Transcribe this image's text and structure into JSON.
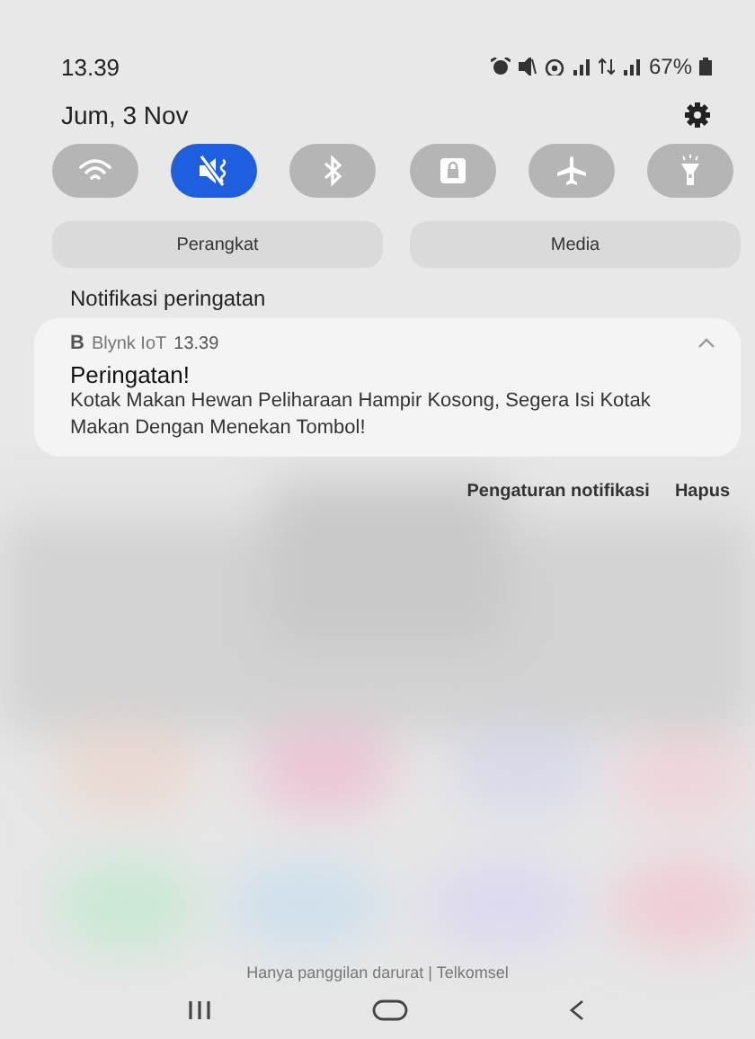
{
  "status_bar": {
    "time": "13.39",
    "battery": "67%"
  },
  "date": "Jum, 3 Nov",
  "quick_toggles": [
    {
      "kind": "wifi",
      "on": false
    },
    {
      "kind": "mute",
      "on": true
    },
    {
      "kind": "bluetooth",
      "on": false
    },
    {
      "kind": "lock",
      "on": false
    },
    {
      "kind": "airplane",
      "on": false
    },
    {
      "kind": "flashlight",
      "on": false
    }
  ],
  "output_buttons": [
    "Perangkat",
    "Media"
  ],
  "section_title": "Notifikasi peringatan",
  "notification": {
    "app": "Blynk IoT",
    "app_initial": "B",
    "time": "13.39",
    "expanded": true,
    "title": "Peringatan!",
    "body": "Kotak Makan Hewan Peliharaan Hampir Kosong, Segera Isi Kotak Makan Dengan Menekan Tombol!"
  },
  "notification_actions": [
    "Pengaturan notifikasi",
    "Hapus"
  ],
  "carrier_text": "Hanya panggilan darurat | Telkomsel"
}
